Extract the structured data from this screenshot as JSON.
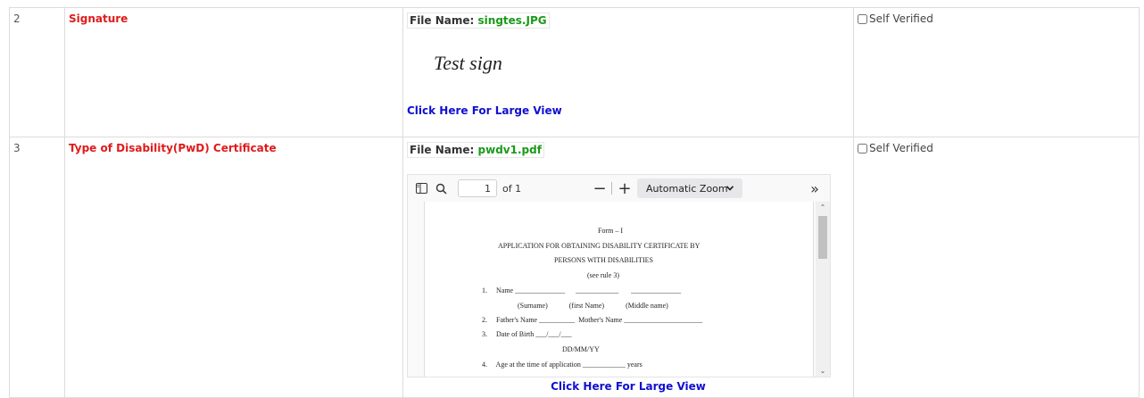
{
  "rows": [
    {
      "sno": "2",
      "doc_name": "Signature",
      "file_label": "File Name:",
      "file_name": "singtes.JPG",
      "signature_text": "Test sign",
      "large_view": "Click Here For Large View",
      "verify_label": "Self Verified"
    },
    {
      "sno": "3",
      "doc_name": "Type of Disability(PwD) Certificate",
      "file_label": "File Name:",
      "file_name": "pwdv1.pdf",
      "large_view": "Click Here For Large View",
      "verify_label": "Self Verified"
    }
  ],
  "pdf_viewer": {
    "page_value": "1",
    "page_of": "of 1",
    "zoom": "Automatic Zoom",
    "zoom_options": [
      "Automatic Zoom"
    ],
    "doc_lines": {
      "l1": "Form – I",
      "l2": "APPLICATION FOR OBTAINING DISABILITY CERTIFICATE BY",
      "l3": "PERSONS WITH DISABILITIES",
      "l4": "(see rule 3)",
      "l5": "1.     Name ______________      ____________       ______________",
      "l6": "(Surname)            (first Name)            (Middle name)",
      "l7": "2.     Father's Name __________  Mother's Name ______________________",
      "l8": "3.     Date of Birth ___/___/___",
      "l9": "DD/MM/YY",
      "l10": "4.     Age at the time of application ____________ years"
    }
  },
  "colors": {
    "doc_name": "#e01b1b",
    "file_name": "#1a9a1a",
    "link": "#1010d0"
  }
}
